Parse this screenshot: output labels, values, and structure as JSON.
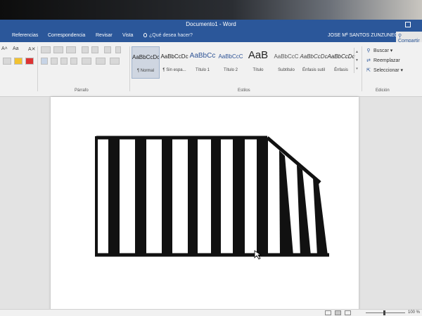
{
  "window": {
    "title": "Documento1 - Word"
  },
  "tabs": [
    {
      "label": "Referencias"
    },
    {
      "label": "Correspondencia"
    },
    {
      "label": "Revisar"
    },
    {
      "label": "Vista"
    }
  ],
  "tell_me": {
    "label": "¿Qué desea hacer?"
  },
  "user": {
    "name": "JOSE Mª SANTOS ZUNZUNEGUI"
  },
  "share": {
    "label": "Compartir"
  },
  "ribbon": {
    "font_size_label": "Aa",
    "groups": {
      "paragraph": "Párrafo",
      "styles": "Estilos",
      "editing": "Edición"
    },
    "styles": [
      {
        "sample": "AaBbCcDc",
        "name": "¶ Normal",
        "selected": true
      },
      {
        "sample": "AaBbCcDc",
        "name": "¶ Sin espa...",
        "selected": false
      },
      {
        "sample": "AaBbCc",
        "name": "Título 1",
        "selected": false
      },
      {
        "sample": "AaBbCcC",
        "name": "Título 2",
        "selected": false
      },
      {
        "sample": "AaB",
        "name": "Título",
        "selected": false
      },
      {
        "sample": "AaBbCcC",
        "name": "Subtítulo",
        "selected": false
      },
      {
        "sample": "AaBbCcDc",
        "name": "Énfasis sutil",
        "selected": false
      },
      {
        "sample": "AaBbCcDc",
        "name": "Énfasis",
        "selected": false
      }
    ],
    "editing": {
      "find": "Buscar",
      "replace": "Reemplazar",
      "select": "Seleccionar"
    }
  },
  "drawing": {
    "description_icon": "fence-shape",
    "fill": "#111111"
  },
  "status": {
    "zoom": "100 %"
  },
  "colors": {
    "accent": "#2b579a",
    "ribbon": "#f1f1f1",
    "page": "#ffffff"
  }
}
